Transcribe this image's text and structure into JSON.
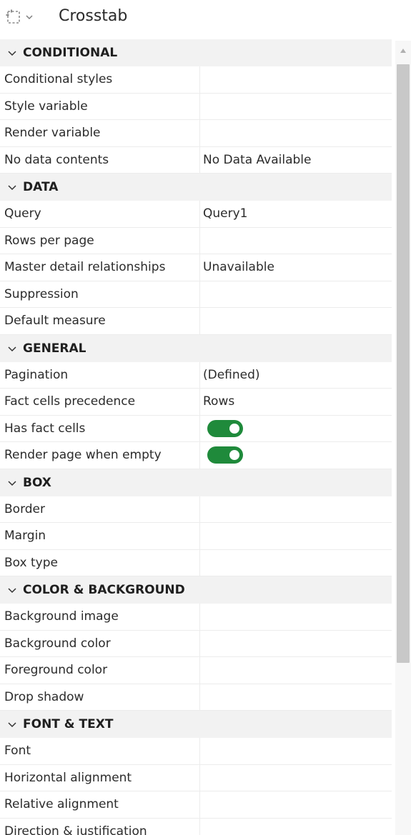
{
  "header": {
    "title": "Crosstab"
  },
  "sections": {
    "conditional": {
      "title": "CONDITIONAL",
      "rows": [
        {
          "label": "Conditional styles",
          "value": ""
        },
        {
          "label": "Style variable",
          "value": ""
        },
        {
          "label": "Render variable",
          "value": ""
        },
        {
          "label": "No data contents",
          "value": "No Data Available"
        }
      ]
    },
    "data": {
      "title": "DATA",
      "rows": [
        {
          "label": "Query",
          "value": "Query1"
        },
        {
          "label": "Rows per page",
          "value": ""
        },
        {
          "label": "Master detail relationships",
          "value": "Unavailable"
        },
        {
          "label": "Suppression",
          "value": ""
        },
        {
          "label": "Default measure",
          "value": ""
        }
      ]
    },
    "general": {
      "title": "GENERAL",
      "rows": [
        {
          "label": "Pagination",
          "value": "(Defined)"
        },
        {
          "label": "Fact cells precedence",
          "value": "Rows"
        },
        {
          "label": "Has fact cells",
          "toggle": true
        },
        {
          "label": "Render page when empty",
          "toggle": true
        }
      ]
    },
    "box": {
      "title": "BOX",
      "rows": [
        {
          "label": "Border",
          "value": ""
        },
        {
          "label": "Margin",
          "value": ""
        },
        {
          "label": "Box type",
          "value": ""
        }
      ]
    },
    "color_background": {
      "title": "COLOR & BACKGROUND",
      "rows": [
        {
          "label": "Background image",
          "value": ""
        },
        {
          "label": "Background color",
          "value": ""
        },
        {
          "label": "Foreground color",
          "value": ""
        },
        {
          "label": "Drop shadow",
          "value": ""
        }
      ]
    },
    "font_text": {
      "title": "FONT & TEXT",
      "rows": [
        {
          "label": "Font",
          "value": ""
        },
        {
          "label": "Horizontal alignment",
          "value": ""
        },
        {
          "label": "Relative alignment",
          "value": ""
        },
        {
          "label": "Direction & justification",
          "value": ""
        }
      ]
    }
  },
  "colors": {
    "toggle_on": "#1f8a3b",
    "section_bg": "#f2f2f2"
  },
  "icons": {
    "object": "crosstab-select-icon",
    "expand": "chevron-down-icon",
    "scroll_up": "scroll-up-arrow-icon"
  }
}
